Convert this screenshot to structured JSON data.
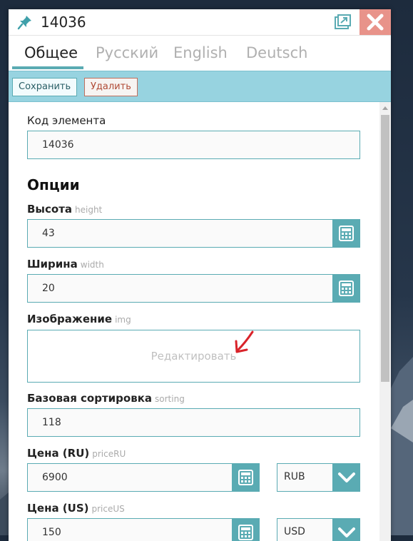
{
  "window": {
    "title": "14036"
  },
  "tabs": [
    {
      "label": "Общее",
      "active": true
    },
    {
      "label": "Русский",
      "active": false
    },
    {
      "label": "English",
      "active": false
    },
    {
      "label": "Deutsch",
      "active": false
    }
  ],
  "toolbar": {
    "save_label": "Сохранить",
    "delete_label": "Удалить"
  },
  "form": {
    "element_code": {
      "label": "Код элемента",
      "value": "14036"
    },
    "options_title": "Опции",
    "height": {
      "label": "Высота",
      "hint": "height",
      "value": "43"
    },
    "width": {
      "label": "Ширина",
      "hint": "width",
      "value": "20"
    },
    "image": {
      "label": "Изображение",
      "hint": "img",
      "edit_text": "Редактировать"
    },
    "sorting": {
      "label": "Базовая сортировка",
      "hint": "sorting",
      "value": "118"
    },
    "price_ru": {
      "label": "Цена (RU)",
      "hint": "priceRU",
      "value": "6900",
      "currency": "RUB"
    },
    "price_us": {
      "label": "Цена (US)",
      "hint": "priceUS",
      "value": "150",
      "currency": "USD"
    }
  },
  "icons": {
    "pin": "pin-icon",
    "popout": "popout-icon",
    "close": "close-icon",
    "calculator": "calculator-icon",
    "chevron": "chevron-down-icon",
    "annotation_arrow": "red-arrow-icon"
  },
  "colors": {
    "accent": "#5aabb3",
    "toolbar_bg": "#97d3e0",
    "close_bg": "#e8938a",
    "delete_text": "#b04a35",
    "annotation_arrow": "#d9232a"
  }
}
